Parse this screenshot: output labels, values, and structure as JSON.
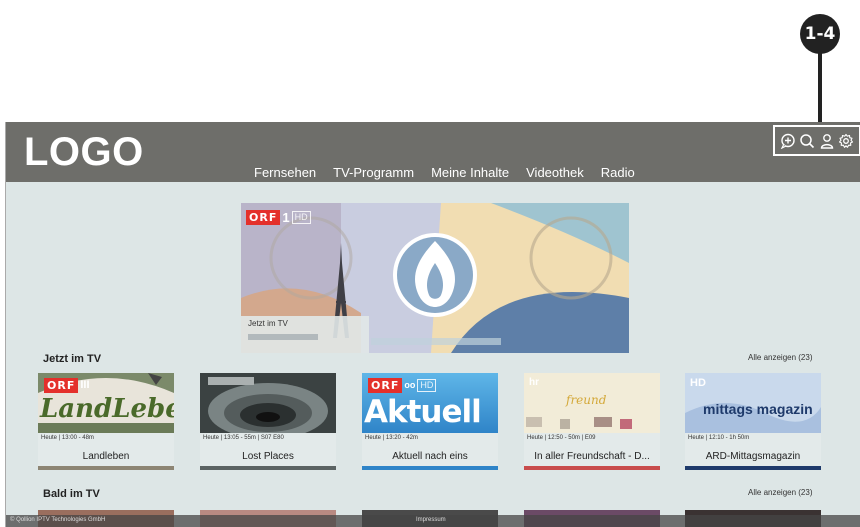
{
  "callout": {
    "label": "1-4"
  },
  "header": {
    "logo": "LOGO",
    "nav": [
      "Fernsehen",
      "TV-Programm",
      "Meine Inhalte",
      "Videothek",
      "Radio"
    ],
    "icons": [
      "chat-add-icon",
      "search-icon",
      "user-icon",
      "gear-icon"
    ]
  },
  "hero": {
    "channel": {
      "brand": "ORF",
      "number": "1",
      "hd": "HD"
    },
    "label": "Jetzt im TV"
  },
  "sections": [
    {
      "title": "Jetzt im TV",
      "show_all": "Alle anzeigen (23)"
    },
    {
      "title": "Bald im TV",
      "show_all": "Alle anzeigen (23)"
    }
  ],
  "cards": [
    {
      "meta": "Heute | 13:00 - 48m",
      "title": "Landleben",
      "image_text": "LandLeben",
      "channel": "ORF III"
    },
    {
      "meta": "Heute | 13:05 - 55m | S07 E80",
      "title": "Lost Places",
      "image_text": "",
      "channel": ""
    },
    {
      "meta": "Heute | 13:20 - 42m",
      "title": "Aktuell nach eins",
      "image_text": "Aktuell",
      "channel": "ORF HD"
    },
    {
      "meta": "Heute | 12:50 - 50m | E09",
      "title": "In aller Freundschaft - D...",
      "image_text": "freund",
      "channel": "hr"
    },
    {
      "meta": "Heute | 12:10 - 1h 50m",
      "title": "ARD-Mittagsmagazin",
      "image_text": "mittags magazin",
      "channel": "HD"
    }
  ],
  "footer": {
    "copyright": "© Qollion IPTV Technologies GmbH",
    "impressum": "Impressum"
  },
  "colors": {
    "header_bg": "#6e6e6a",
    "content_bg": "#dde6e6",
    "orf_red": "#e4302b",
    "callout": "#222222"
  }
}
